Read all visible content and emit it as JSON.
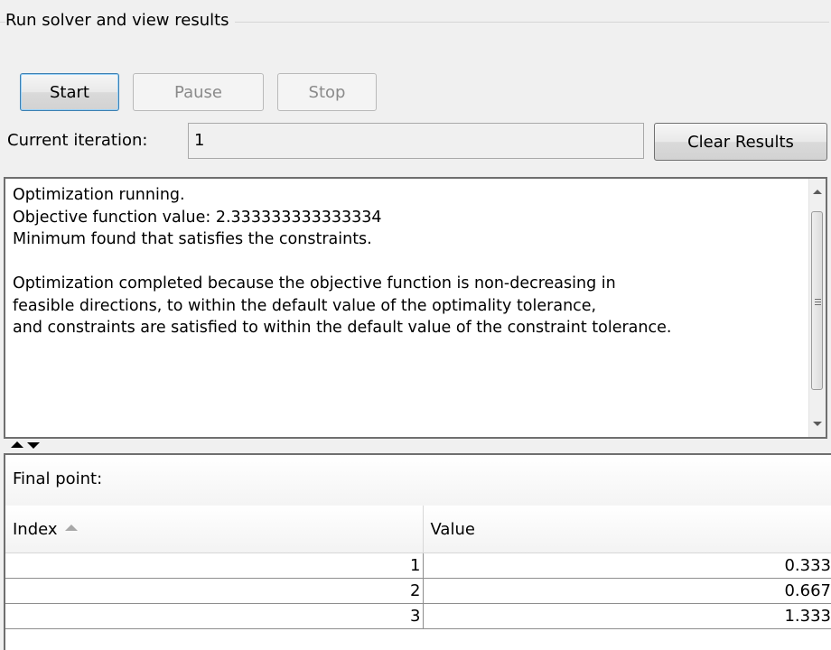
{
  "group": {
    "title": "Run solver and view results"
  },
  "buttons": {
    "start": "Start",
    "pause": "Pause",
    "stop": "Stop",
    "clear": "Clear Results"
  },
  "iteration": {
    "label": "Current iteration:",
    "value": "1"
  },
  "output": {
    "text": "Optimization running.\nObjective function value: 2.333333333333334\nMinimum found that satisfies the constraints.\n\nOptimization completed because the objective function is non-decreasing in\nfeasible directions, to within the default value of the optimality tolerance,\nand constraints are satisfied to within the default value of the constraint tolerance."
  },
  "final_point": {
    "title": "Final point:",
    "columns": [
      "Index",
      "Value"
    ],
    "rows": [
      {
        "index": "1",
        "value": "0.333"
      },
      {
        "index": "2",
        "value": "0.667"
      },
      {
        "index": "3",
        "value": "1.333"
      }
    ]
  }
}
